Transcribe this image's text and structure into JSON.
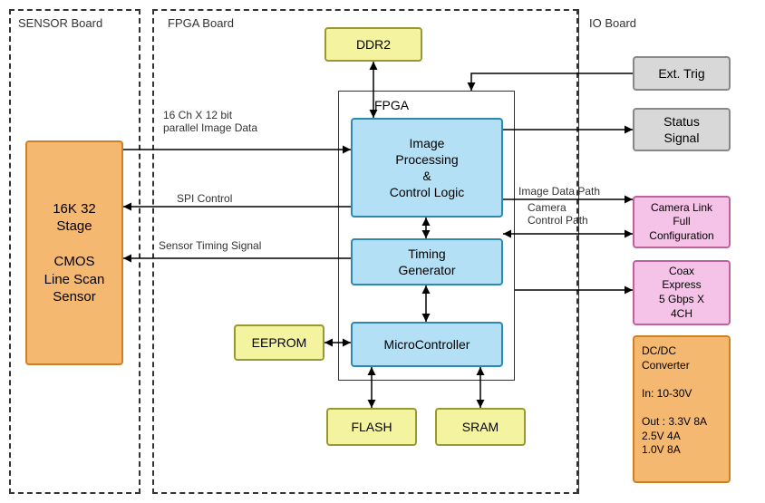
{
  "boards": {
    "sensor": "SENSOR Board",
    "fpga": "FPGA Board",
    "io": "IO Board"
  },
  "blocks": {
    "sensor": "16K 32\nStage\n\nCMOS\nLine Scan\nSensor",
    "ddr2": "DDR2",
    "eeprom": "EEPROM",
    "flash": "FLASH",
    "sram": "SRAM",
    "imgproc": "Image\nProcessing\n&\nControl Logic",
    "timing": "Timing\nGenerator",
    "mcu": "MicroController",
    "exttrig": "Ext. Trig",
    "status": "Status\nSignal",
    "camlink": "Camera Link\nFull\nConfiguration",
    "coax": "Coax\nExpress\n5 Gbps X\n4CH",
    "dcdc": "DC/DC\nConverter\n\nIn: 10-30V\n\nOut : 3.3V 8A\n        2.5V 4A\n        1.0V 8A"
  },
  "labels": {
    "fpga_inner": "FPGA",
    "imgdata": "16 Ch X 12 bit\nparallel Image Data",
    "spi": "SPI Control",
    "timing_sig": "Sensor Timing Signal",
    "img_path": "Image Data Path",
    "cam_ctrl": "Camera\nControl Path"
  }
}
